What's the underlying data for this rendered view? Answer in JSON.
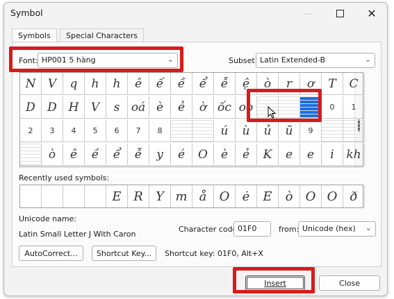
{
  "window": {
    "title": "Symbol"
  },
  "tabs": [
    {
      "label": "Symbols",
      "underline": "S"
    },
    {
      "label": "Special Characters",
      "underline": "p"
    }
  ],
  "font": {
    "label": "Font:",
    "value": "HP001 5 hàng"
  },
  "subset": {
    "label": "Subset:",
    "value": "Latin Extended-B"
  },
  "symbol_grid": {
    "rows": [
      [
        "N",
        "V",
        "q",
        "h",
        "h",
        "ê",
        "ế",
        "ề",
        "ể",
        "ễ",
        "ệ",
        "ò",
        "r",
        "ơ",
        "T",
        "C"
      ],
      [
        "D",
        "D",
        "H",
        "V",
        "s",
        "oá",
        "è",
        "ẻ",
        "ờ",
        "ốc",
        "oo",
        "",
        "",
        "",
        "0",
        "1"
      ],
      [
        "2",
        "3",
        "4",
        "5",
        "6",
        "7",
        "8",
        "",
        "",
        "ú",
        "ù",
        "ủ",
        "ũ",
        "9",
        "",
        ""
      ],
      [
        "",
        "ò",
        "ê",
        "ề",
        "ể",
        "ễ",
        "y",
        "é",
        "O",
        "è",
        "ẻ",
        "K",
        "e",
        "e",
        "i",
        "kh"
      ]
    ],
    "selected_cell": [
      1,
      13
    ]
  },
  "recent": {
    "label": "Recently used symbols:",
    "symbols": [
      "",
      "",
      "",
      "",
      "E",
      "R",
      "Y",
      "m",
      "å",
      "O",
      "ė",
      "E",
      "ò",
      "O",
      "O",
      "ð"
    ]
  },
  "unicode_name": {
    "label": "Unicode name:",
    "value": "Latin Small Letter J With Caron"
  },
  "character_code": {
    "label": "Character code:",
    "value": "01F0"
  },
  "from": {
    "label": "from:",
    "value": "Unicode (hex)"
  },
  "buttons": {
    "autocorrect": "AutoCorrect...",
    "shortcut_key": "Shortcut Key...",
    "insert": "Insert",
    "close": "Close"
  },
  "shortcut_text": "Shortcut key: 01F0, Alt+X",
  "colors": {
    "highlight": "#d81b1b",
    "selection": "#1a6fe0"
  }
}
